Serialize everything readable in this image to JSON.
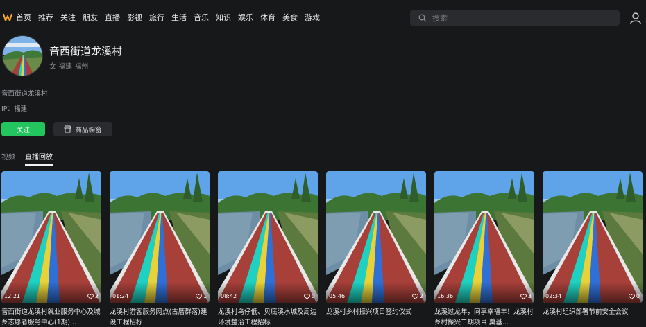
{
  "nav": {
    "items": [
      "首页",
      "推荐",
      "关注",
      "朋友",
      "直播",
      "影视",
      "旅行",
      "生活",
      "音乐",
      "知识",
      "娱乐",
      "体育",
      "美食",
      "游戏"
    ]
  },
  "search": {
    "placeholder": "搜索"
  },
  "profile": {
    "name": "音西街道龙溪村",
    "meta": "女  福建  福州",
    "bio": "音西街道龙溪村",
    "ip": "IP：福建"
  },
  "actions": {
    "follow_label": "关注",
    "shop_label": "商品橱窗"
  },
  "tabs": [
    {
      "label": "视频",
      "active": false
    },
    {
      "label": "直播回放",
      "active": true
    }
  ],
  "videos": [
    {
      "duration": "12:21",
      "likes": "2",
      "title": "音西街道龙溪村就业服务中心及城乡志愿者服务中心(1期)..."
    },
    {
      "duration": "01:24",
      "likes": "1",
      "title": "龙溪村游客服务网点(古厝群落)建设工程招标"
    },
    {
      "duration": "08:42",
      "likes": "0",
      "title": "龙溪村乌仔低、贝底溪水城及周边环境整治工程招标"
    },
    {
      "duration": "05:46",
      "likes": "2",
      "title": "龙溪村乡村振兴项目签约仪式"
    },
    {
      "duration": "16:36",
      "likes": "3",
      "title": "龙溪过龙年，同享幸福年！龙溪村乡村振兴二期项目.奠基..."
    },
    {
      "duration": "02:34",
      "likes": "0",
      "title": "龙溪村组织部署节前安全会议"
    }
  ],
  "colors": {
    "accent": "#22c55e",
    "background": "#17181a",
    "track": "#a8403a"
  }
}
